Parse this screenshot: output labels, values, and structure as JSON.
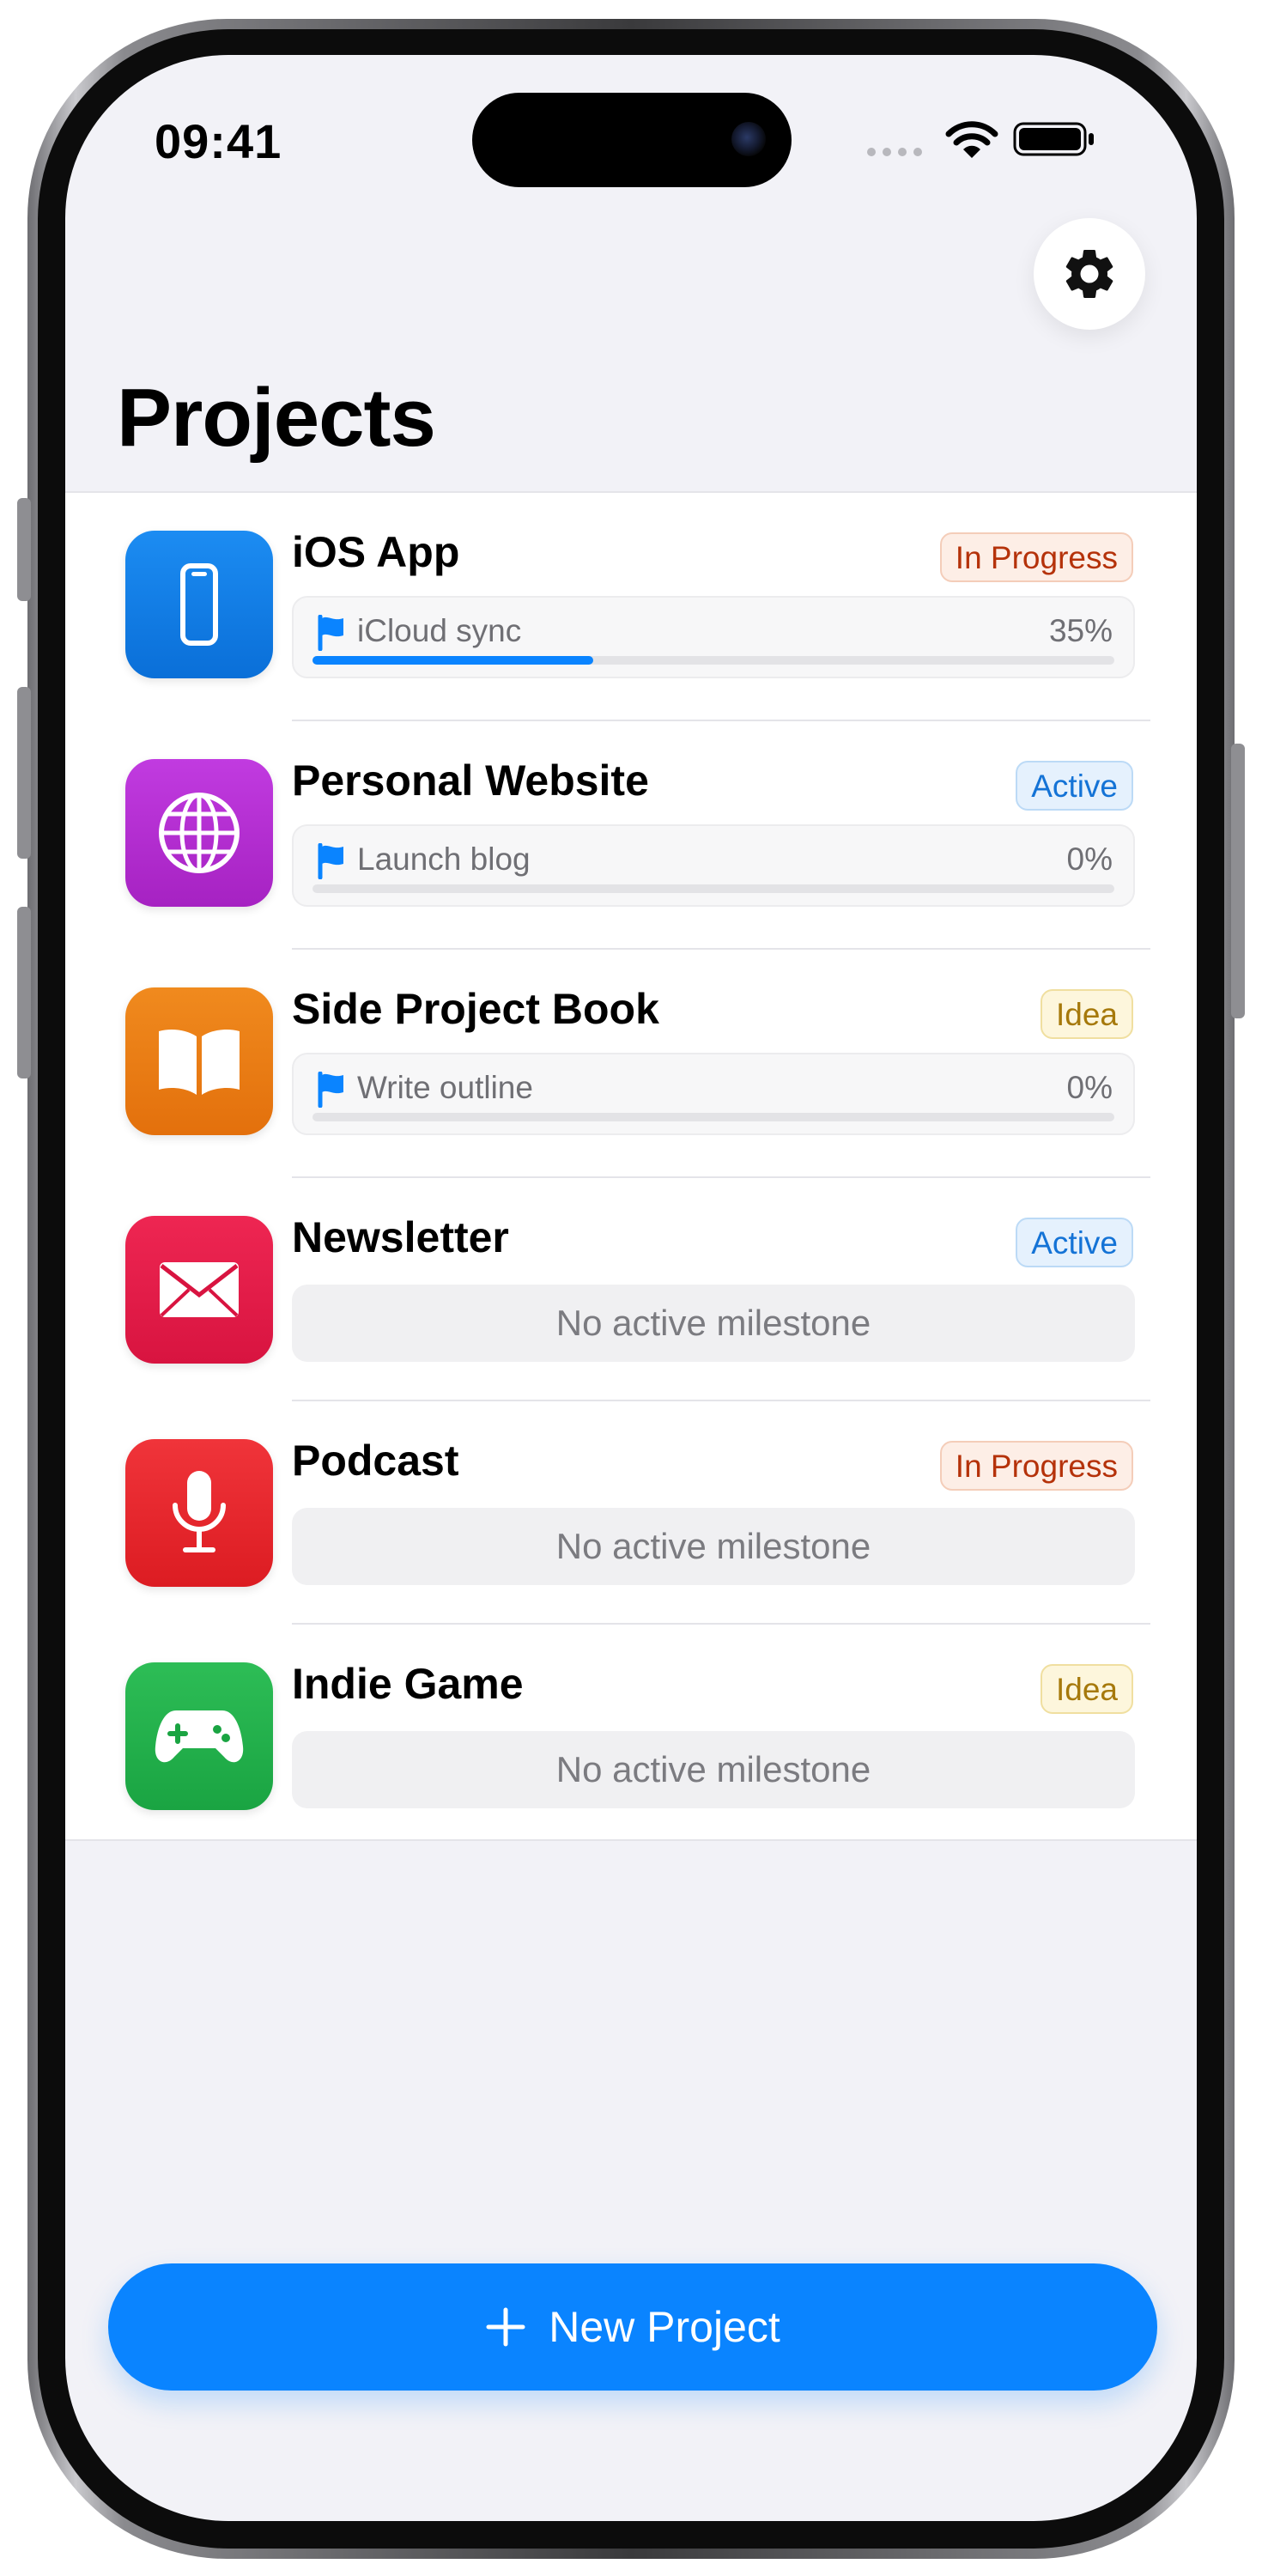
{
  "status_bar": {
    "time": "09:41"
  },
  "header": {
    "title": "Projects",
    "settings_icon": "gear-icon"
  },
  "colors": {
    "accent": "#0a84ff",
    "in_progress": "#b5320a",
    "active": "#1473d6",
    "idea": "#a6790b"
  },
  "projects": [
    {
      "name": "iOS App",
      "status": "In Progress",
      "icon": "iphone-icon",
      "icon_color": "#0a7ae6",
      "milestone": {
        "name": "iCloud sync",
        "progress": 35,
        "progress_label": "35%"
      }
    },
    {
      "name": "Personal Website",
      "status": "Active",
      "icon": "globe-icon",
      "icon_color": "#b62ed0",
      "milestone": {
        "name": "Launch blog",
        "progress": 0,
        "progress_label": "0%"
      }
    },
    {
      "name": "Side Project Book",
      "status": "Idea",
      "icon": "book-icon",
      "icon_color": "#ec7c14",
      "milestone": {
        "name": "Write outline",
        "progress": 0,
        "progress_label": "0%"
      }
    },
    {
      "name": "Newsletter",
      "status": "Active",
      "icon": "envelope-icon",
      "icon_color": "#e51c48",
      "empty_milestone": "No active milestone"
    },
    {
      "name": "Podcast",
      "status": "In Progress",
      "icon": "microphone-icon",
      "icon_color": "#e8262c",
      "empty_milestone": "No active milestone"
    },
    {
      "name": "Indie Game",
      "status": "Idea",
      "icon": "gamepad-icon",
      "icon_color": "#22b14c",
      "empty_milestone": "No active milestone"
    }
  ],
  "footer": {
    "new_project_label": "New Project",
    "icon": "plus-icon"
  }
}
